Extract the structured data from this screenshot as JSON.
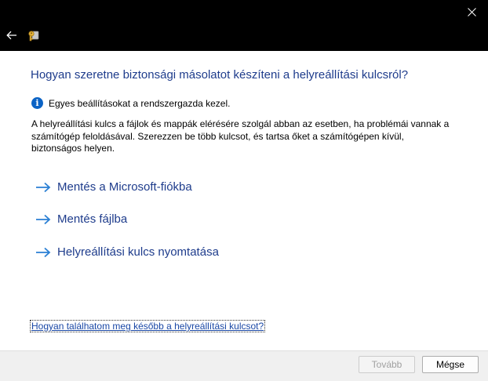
{
  "window": {
    "close_icon": "close-icon",
    "back_icon": "back-arrow-icon",
    "app_icon": "key-recovery-icon"
  },
  "main": {
    "heading": "Hogyan szeretne biztonsági másolatot készíteni a helyreállítási kulcsról?",
    "info_text": "Egyes beállításokat a rendszergazda kezel.",
    "description": "A helyreállítási kulcs a fájlok és mappák elérésére szolgál abban az esetben, ha problémái vannak a számítógép feloldásával. Szerezzen be több kulcsot, és tartsa őket a számítógépen kívül, biztonságos helyen.",
    "options": [
      {
        "label": "Mentés a Microsoft-fiókba"
      },
      {
        "label": "Mentés fájlba"
      },
      {
        "label": "Helyreállítási kulcs nyomtatása"
      }
    ],
    "help_link": "Hogyan találhatom meg később a helyreállítási kulcsot?"
  },
  "footer": {
    "next_label": "Tovább",
    "cancel_label": "Mégse"
  },
  "colors": {
    "accent": "#1e3c8c",
    "arrow": "#2a7fd4",
    "info": "#0b63c5"
  }
}
